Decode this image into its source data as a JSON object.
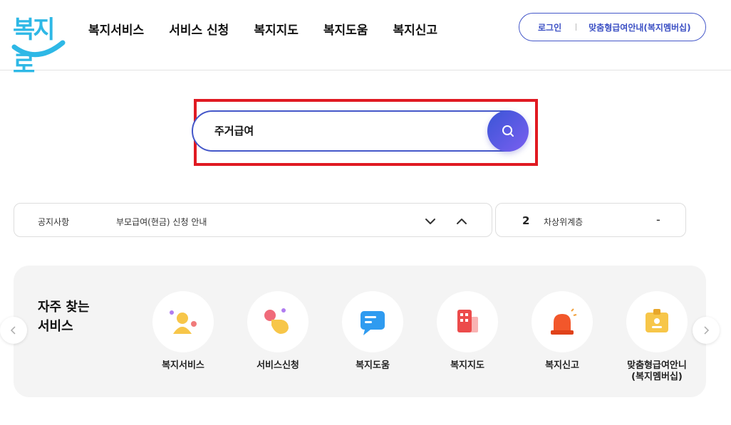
{
  "logo": {
    "text": "복지로"
  },
  "nav": {
    "items": [
      "복지서비스",
      "서비스 신청",
      "복지지도",
      "복지도움",
      "복지신고"
    ]
  },
  "auth": {
    "login": "로그인",
    "member": "맞춤형급여안내(복지멤버십)"
  },
  "search": {
    "value": "주거급여"
  },
  "notice": {
    "label": "공지사항",
    "text": "부모급여(현금) 신청 안내"
  },
  "rank": {
    "number": "2",
    "keyword": "차상위계층",
    "change": "-"
  },
  "quick": {
    "title": "자주 찾는\n서비스",
    "items": [
      {
        "label": "복지서비스",
        "icon": "person-icon"
      },
      {
        "label": "서비스신청",
        "icon": "hand-tap-icon"
      },
      {
        "label": "복지도움",
        "icon": "chat-bubble-icon"
      },
      {
        "label": "복지지도",
        "icon": "building-icon"
      },
      {
        "label": "복지신고",
        "icon": "siren-icon"
      },
      {
        "label": "맞춤형급여안니\n(복지멤버십)",
        "icon": "id-badge-icon"
      }
    ]
  },
  "colors": {
    "brand_blue": "#4457c9",
    "logo_cyan": "#2eb8e6",
    "highlight_red": "#e01a22"
  }
}
